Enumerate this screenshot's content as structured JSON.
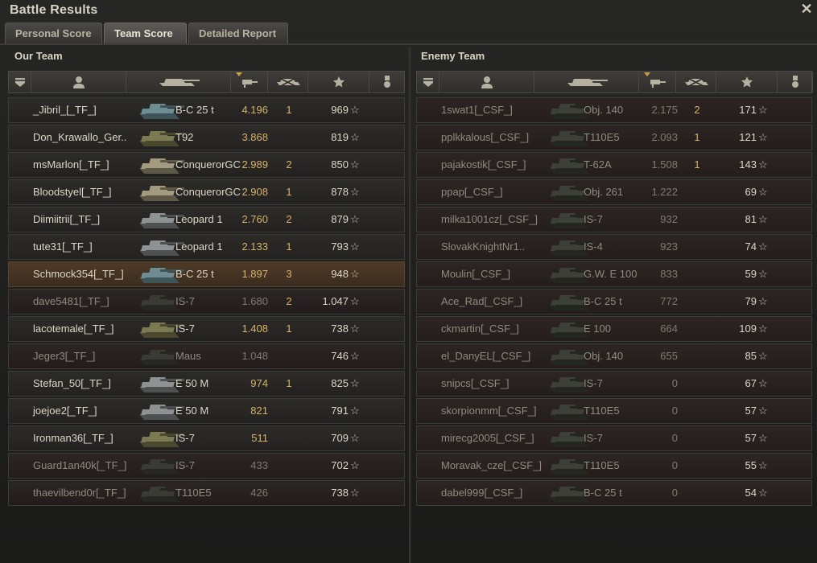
{
  "window": {
    "title": "Battle Results",
    "close_icon": "close-icon"
  },
  "tabs": [
    {
      "label": "Personal Score",
      "active": false
    },
    {
      "label": "Team Score",
      "active": true
    },
    {
      "label": "Detailed Report",
      "active": false
    }
  ],
  "teams": {
    "ours": {
      "title": "Our Team"
    },
    "enemy": {
      "title": "Enemy Team"
    }
  },
  "columns": [
    "squad-icon",
    "player-icon",
    "tank-icon",
    "damage-icon",
    "kills-icon",
    "star-icon",
    "medal-icon"
  ],
  "colors": {
    "accent": "#d9b26a",
    "self_row": "#4e3a28",
    "enemy_tint": "#2d2523"
  },
  "our_team": [
    {
      "name": "_Jibril_[_TF_]",
      "tank": "B-C 25 t",
      "xp": "4.196",
      "kills": "1",
      "score": "969",
      "alive": true,
      "tone": "blue"
    },
    {
      "name": "Don_Krawallo_Ger..",
      "tank": "T92",
      "xp": "3.868",
      "kills": "",
      "score": "819",
      "alive": true,
      "tone": "olive"
    },
    {
      "name": "msMarlon[_TF_]",
      "tank": "ConquerorGC",
      "xp": "2.989",
      "kills": "2",
      "score": "850",
      "alive": true,
      "tone": "tan"
    },
    {
      "name": "Bloodstyel[_TF_]",
      "tank": "ConquerorGC",
      "xp": "2.908",
      "kills": "1",
      "score": "878",
      "alive": true,
      "tone": "tan"
    },
    {
      "name": "Diimiitrii[_TF_]",
      "tank": "Leopard 1",
      "xp": "2.760",
      "kills": "2",
      "score": "879",
      "alive": true,
      "tone": "grey"
    },
    {
      "name": "tute31[_TF_]",
      "tank": "Leopard 1",
      "xp": "2.133",
      "kills": "1",
      "score": "793",
      "alive": true,
      "tone": "grey"
    },
    {
      "name": "Schmock354[_TF_]",
      "tank": "B-C 25 t",
      "xp": "1.897",
      "kills": "3",
      "score": "948",
      "alive": true,
      "tone": "blue",
      "self": true
    },
    {
      "name": "dave5481[_TF_]",
      "tank": "IS-7",
      "xp": "1.680",
      "kills": "2",
      "score": "1.047",
      "alive": false,
      "tone": "dark"
    },
    {
      "name": "lacotemale[_TF_]",
      "tank": "IS-7",
      "xp": "1.408",
      "kills": "1",
      "score": "738",
      "alive": true,
      "tone": "olive"
    },
    {
      "name": "Jeger3[_TF_]",
      "tank": "Maus",
      "xp": "1.048",
      "kills": "",
      "score": "746",
      "alive": false,
      "tone": "dark"
    },
    {
      "name": "Stefan_50[_TF_]",
      "tank": "E 50 M",
      "xp": "974",
      "kills": "1",
      "score": "825",
      "alive": true,
      "tone": "grey"
    },
    {
      "name": "joejoe2[_TF_]",
      "tank": "E 50 M",
      "xp": "821",
      "kills": "",
      "score": "791",
      "alive": true,
      "tone": "grey"
    },
    {
      "name": "Ironman36[_TF_]",
      "tank": "IS-7",
      "xp": "511",
      "kills": "",
      "score": "709",
      "alive": true,
      "tone": "olive"
    },
    {
      "name": "Guard1an40k[_TF_]",
      "tank": "IS-7",
      "xp": "433",
      "kills": "",
      "score": "702",
      "alive": false,
      "tone": "dark"
    },
    {
      "name": "thaevilbend0r[_TF_]",
      "tank": "T110E5",
      "xp": "426",
      "kills": "",
      "score": "738",
      "alive": false,
      "tone": "dark"
    }
  ],
  "enemy_team": [
    {
      "name": "1swat1[_CSF_]",
      "tank": "Obj. 140",
      "xp": "2.175",
      "kills": "2",
      "score": "171"
    },
    {
      "name": "pplkkalous[_CSF_]",
      "tank": "T110E5",
      "xp": "2.093",
      "kills": "1",
      "score": "121"
    },
    {
      "name": "pajakostik[_CSF_]",
      "tank": "T-62A",
      "xp": "1.508",
      "kills": "1",
      "score": "143"
    },
    {
      "name": "ppap[_CSF_]",
      "tank": "Obj. 261",
      "xp": "1.222",
      "kills": "",
      "score": "69"
    },
    {
      "name": "milka1001cz[_CSF_]",
      "tank": "IS-7",
      "xp": "932",
      "kills": "",
      "score": "81"
    },
    {
      "name": "SlovakKnightNr1..",
      "tank": "IS-4",
      "xp": "923",
      "kills": "",
      "score": "74"
    },
    {
      "name": "Moulin[_CSF_]",
      "tank": "G.W. E 100",
      "xp": "833",
      "kills": "",
      "score": "59"
    },
    {
      "name": "Ace_Rad[_CSF_]",
      "tank": "B-C 25 t",
      "xp": "772",
      "kills": "",
      "score": "79"
    },
    {
      "name": "ckmartin[_CSF_]",
      "tank": "E 100",
      "xp": "664",
      "kills": "",
      "score": "109"
    },
    {
      "name": "el_DanyEL[_CSF_]",
      "tank": "Obj. 140",
      "xp": "655",
      "kills": "",
      "score": "85"
    },
    {
      "name": "snipcs[_CSF_]",
      "tank": "IS-7",
      "xp": "0",
      "kills": "",
      "score": "67"
    },
    {
      "name": "skorpionmm[_CSF_]",
      "tank": "T110E5",
      "xp": "0",
      "kills": "",
      "score": "57"
    },
    {
      "name": "mirecg2005[_CSF_]",
      "tank": "IS-7",
      "xp": "0",
      "kills": "",
      "score": "57"
    },
    {
      "name": "Moravak_cze[_CSF_]",
      "tank": "T110E5",
      "xp": "0",
      "kills": "",
      "score": "55"
    },
    {
      "name": "dabel999[_CSF_]",
      "tank": "B-C 25 t",
      "xp": "0",
      "kills": "",
      "score": "54"
    }
  ]
}
